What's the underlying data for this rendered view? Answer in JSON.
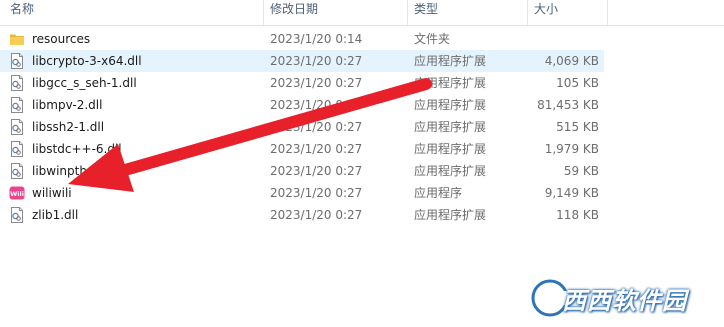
{
  "columns": {
    "name": "名称",
    "date": "修改日期",
    "type": "类型",
    "size": "大小"
  },
  "files": [
    {
      "name": "resources",
      "date": "2023/1/20 0:14",
      "type": "文件夹",
      "size": "",
      "icon": "folder-icon",
      "selected": false
    },
    {
      "name": "libcrypto-3-x64.dll",
      "date": "2023/1/20 0:27",
      "type": "应用程序扩展",
      "size": "4,069 KB",
      "icon": "dll-file-icon",
      "selected": true
    },
    {
      "name": "libgcc_s_seh-1.dll",
      "date": "2023/1/20 0:27",
      "type": "应用程序扩展",
      "size": "105 KB",
      "icon": "dll-file-icon",
      "selected": false
    },
    {
      "name": "libmpv-2.dll",
      "date": "2023/1/20 0:27",
      "type": "应用程序扩展",
      "size": "81,453 KB",
      "icon": "dll-file-icon",
      "selected": false
    },
    {
      "name": "libssh2-1.dll",
      "date": "2023/1/20 0:27",
      "type": "应用程序扩展",
      "size": "515 KB",
      "icon": "dll-file-icon",
      "selected": false
    },
    {
      "name": "libstdc++-6.dll",
      "date": "2023/1/20 0:27",
      "type": "应用程序扩展",
      "size": "1,979 KB",
      "icon": "dll-file-icon",
      "selected": false
    },
    {
      "name": "libwinpthre",
      "date": "2023/1/20 0:27",
      "type": "应用程序扩展",
      "size": "59 KB",
      "icon": "dll-file-icon",
      "selected": false
    },
    {
      "name": "wiliwili",
      "date": "2023/1/20 0:27",
      "type": "应用程序",
      "size": "9,149 KB",
      "icon": "wiliwili-app-icon",
      "selected": false
    },
    {
      "name": "zlib1.dll",
      "date": "2023/1/20 0:27",
      "type": "应用程序扩展",
      "size": "118 KB",
      "icon": "dll-file-icon",
      "selected": false
    }
  ],
  "app_icon_text": "Wili",
  "watermark": {
    "text": "西西软件园"
  },
  "colors": {
    "selection": "#e5f3ff",
    "arrow": "#e8202a",
    "folder": "#f5c343",
    "app_icon": "#f0418c",
    "watermark_blue": "#2f74b8"
  }
}
